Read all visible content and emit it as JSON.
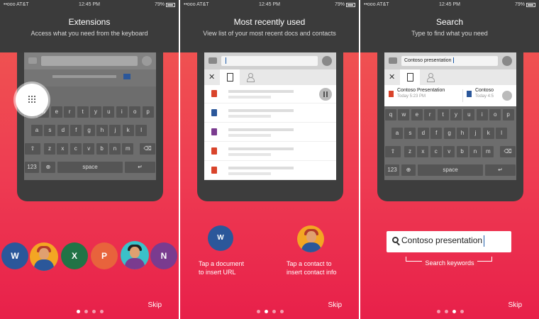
{
  "status": {
    "carrier": "••ooo AT&T",
    "time": "12:45 PM",
    "battery": "79%"
  },
  "panels": [
    {
      "title": "Extensions",
      "subtitle": "Access what you need from the keyboard",
      "active_dot": 0
    },
    {
      "title": "Most recently used",
      "subtitle": "View list of your most recent docs and contacts",
      "active_dot": 1
    },
    {
      "title": "Search",
      "subtitle": "Type to find what you need",
      "active_dot": 2
    }
  ],
  "keyboard": {
    "row1": [
      "q",
      "w",
      "e",
      "r",
      "t",
      "y",
      "u",
      "i",
      "o",
      "p"
    ],
    "row2": [
      "a",
      "s",
      "d",
      "f",
      "g",
      "h",
      "j",
      "k",
      "l"
    ],
    "row3": [
      "z",
      "x",
      "c",
      "v",
      "b",
      "n",
      "m"
    ],
    "num_key": "123",
    "space_key": "space",
    "return_glyph": "↵",
    "shift_glyph": "⇧",
    "backspace_glyph": "⌫",
    "globe_glyph": "⊕"
  },
  "extensions": {
    "apps": [
      {
        "icon": "word-icon",
        "letter": "W",
        "color": "#2b579a"
      },
      {
        "icon": "excel-icon",
        "letter": "X",
        "color": "#217346"
      },
      {
        "icon": "powerpoint-icon",
        "letter": "P",
        "color": "#e8633c"
      },
      {
        "icon": "onenote-icon",
        "letter": "N",
        "color": "#7a3b8f"
      }
    ],
    "avatar_colors": {
      "man_bg": "#f3a623",
      "woman_bg": "#3ac1c9"
    }
  },
  "recent": {
    "file_icon_colors": [
      "#d9442b",
      "#2b579a",
      "#7a3b8f",
      "#d9442b",
      "#d9442b"
    ],
    "doc_caption": "Tap a document\nto insert URL",
    "contact_caption": "Tap a contact to\ninsert contact info",
    "word_letter": "W"
  },
  "search": {
    "query": "Contoso presentation",
    "results": [
      {
        "title": "Contoso Presentation",
        "time": "Today 5:23 PM",
        "color": "#d9442b"
      },
      {
        "title": "Contoso",
        "time": "Today 4:5",
        "color": "#2b579a"
      }
    ],
    "big_query": "Contoso presentation",
    "keywords_label": "Search keywords"
  },
  "skip_label": "Skip"
}
